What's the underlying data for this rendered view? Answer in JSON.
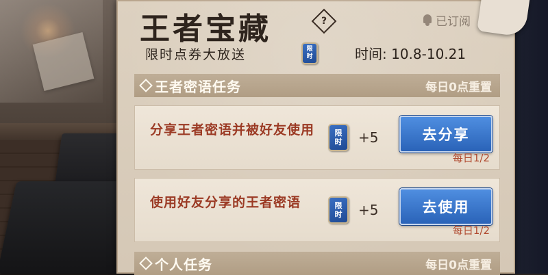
{
  "header": {
    "title": "王者宝藏",
    "help_symbol": "?",
    "subscribed_label": "已订阅",
    "subtitle": "限时点券大放送",
    "time_label": "时间: 10.8-10.21"
  },
  "ticket_badge": {
    "line1": "限",
    "line2": "时"
  },
  "sections": [
    {
      "title": "王者密语任务",
      "reset": "每日0点重置"
    },
    {
      "title": "个人任务",
      "reset": "每日0点重置"
    }
  ],
  "tasks": [
    {
      "text": "分享王者密语并被好友使用",
      "reward": "+5",
      "button": "去分享",
      "progress": "每日1/2",
      "progress_done": 1,
      "progress_total": 2
    },
    {
      "text": "使用好友分享的王者密语",
      "reward": "+5",
      "button": "去使用",
      "progress": "每日1/2",
      "progress_done": 1,
      "progress_total": 2
    }
  ],
  "colors": {
    "accent_button": "#2a63b8",
    "task_text": "#9b3a24",
    "section_bar": "#b09d84"
  }
}
